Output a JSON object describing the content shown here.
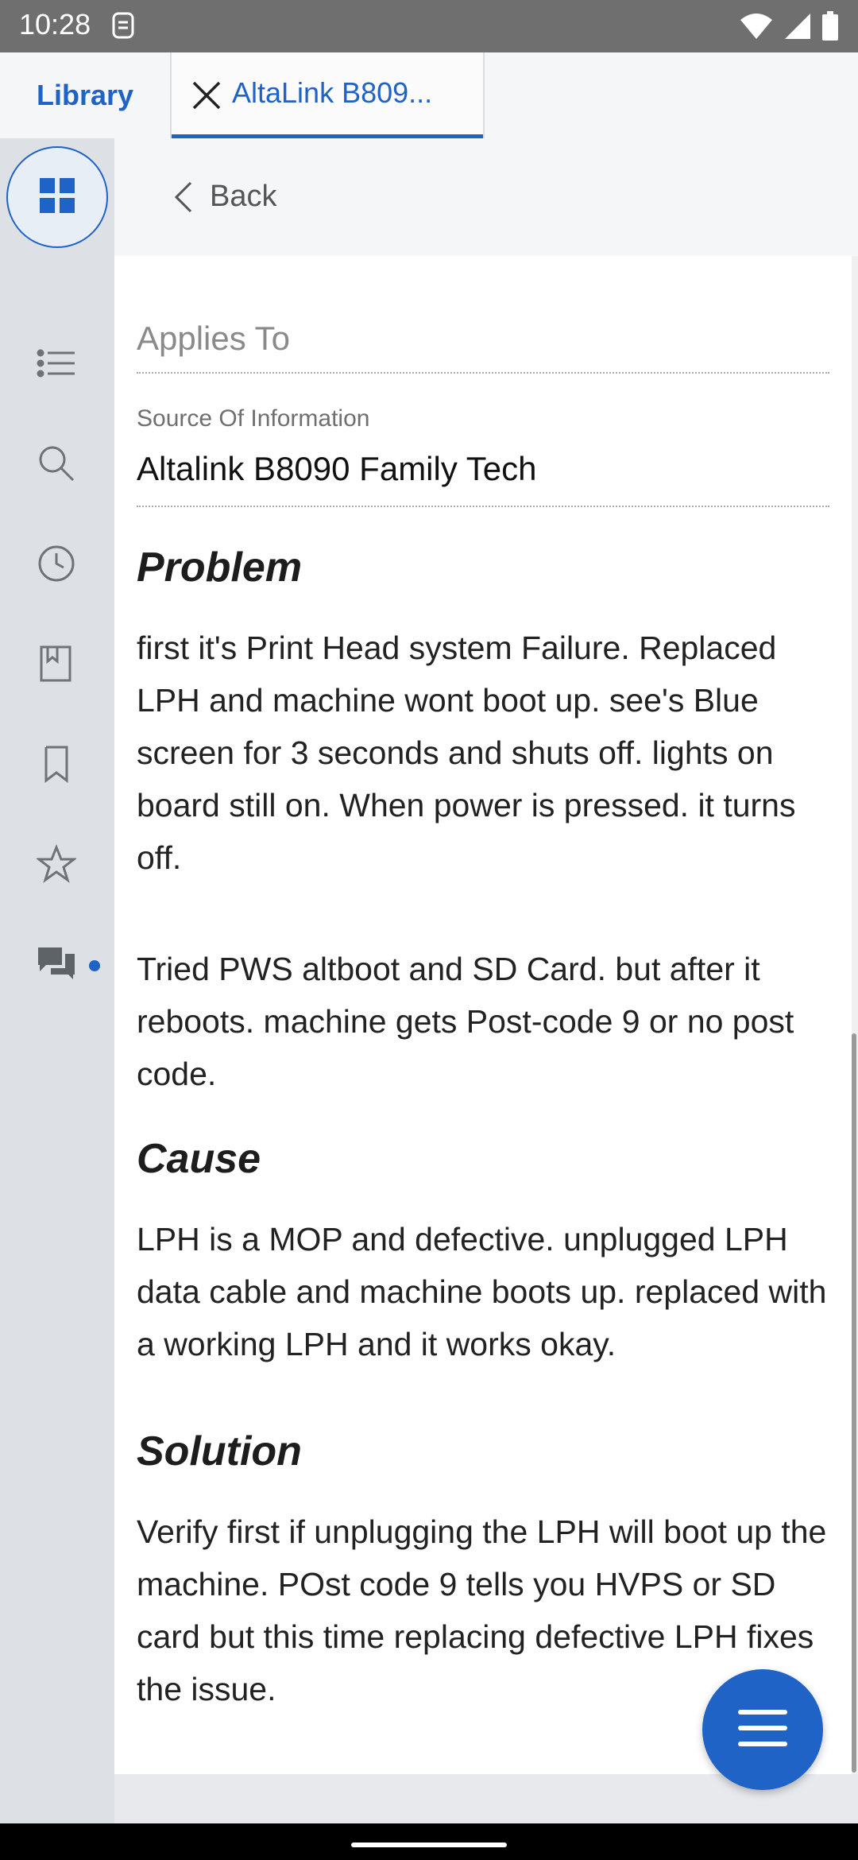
{
  "status_bar": {
    "time": "10:28"
  },
  "tabs": {
    "library": "Library",
    "document": "AltaLink B809..."
  },
  "back": {
    "label": "Back"
  },
  "fields": {
    "applies_to_placeholder": "Applies To",
    "source_label": "Source Of Information",
    "source_value": "Altalink B8090 Family Tech"
  },
  "sections": {
    "problem_title": "Problem",
    "problem_p1": "first it's Print Head system Failure. Replaced LPH and machine wont boot up. see's Blue screen for 3 seconds and shuts off. lights on board still on. When power is pressed. it turns off.",
    "problem_p2": "Tried PWS altboot and SD Card. but after it reboots. machine gets Post-code 9 or no post code.",
    "cause_title": "Cause",
    "cause_p1": "LPH is a MOP and defective. unplugged LPH data cable and machine boots up. replaced with a working LPH and it works okay.",
    "solution_title": "Solution",
    "solution_p1": "Verify first if unplugging the LPH will boot up the machine. POst code 9 tells you HVPS or SD card but this time replacing defective LPH fixes the issue."
  },
  "sidebar": {
    "icons": [
      "grid-icon",
      "list-icon",
      "search-icon",
      "history-icon",
      "book-icon",
      "bookmark-icon",
      "star-icon",
      "chat-icon"
    ]
  },
  "colors": {
    "accent": "#1f63c7",
    "sidebar": "#dde1e5"
  }
}
